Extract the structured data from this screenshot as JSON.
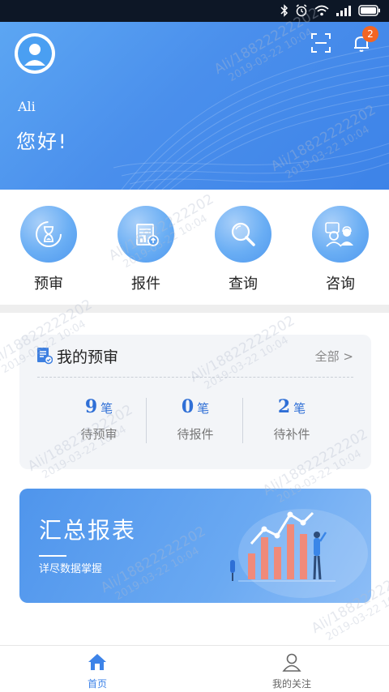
{
  "header": {
    "user_name": "Ali",
    "greeting": "您好!",
    "notification_count": "2"
  },
  "quick_actions": [
    {
      "label": "预审",
      "icon": "hourglass-icon"
    },
    {
      "label": "报件",
      "icon": "document-upload-icon"
    },
    {
      "label": "查询",
      "icon": "search-icon"
    },
    {
      "label": "咨询",
      "icon": "customer-service-icon"
    }
  ],
  "review": {
    "title": "我的预审",
    "all_link": "全部 >",
    "stats": [
      {
        "value": "9",
        "unit": "笔",
        "label": "待预审"
      },
      {
        "value": "0",
        "unit": "笔",
        "label": "待报件"
      },
      {
        "value": "2",
        "unit": "笔",
        "label": "待补件"
      }
    ]
  },
  "report": {
    "title": "汇总报表",
    "subtitle": "详尽数据掌握"
  },
  "tabs": [
    {
      "label": "首页",
      "icon": "home-icon",
      "active": true
    },
    {
      "label": "我的关注",
      "icon": "person-icon",
      "active": false
    }
  ],
  "watermark": {
    "line1": "Ali/18822222202",
    "line2": "2019-03-22 10:04"
  },
  "colors": {
    "accent": "#4a8fec",
    "badge": "#f26522",
    "stat_value": "#2f6fd6"
  }
}
